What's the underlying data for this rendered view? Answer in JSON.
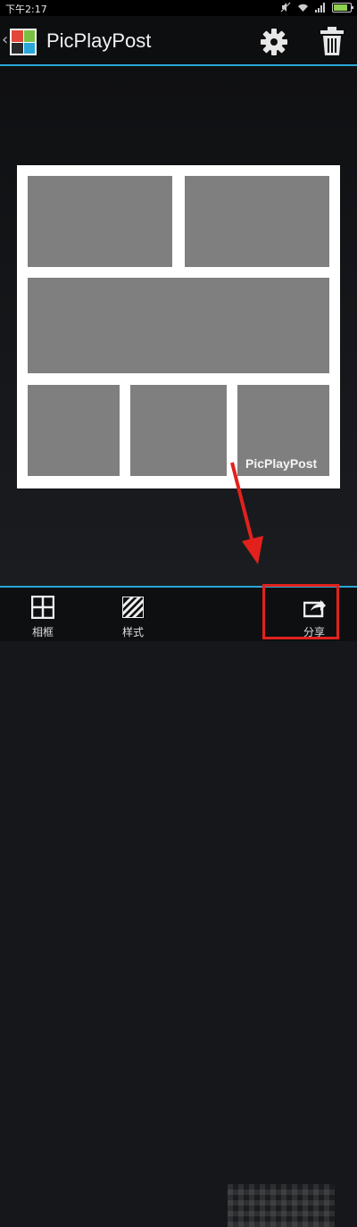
{
  "status_bar": {
    "time": "下午2:17"
  },
  "header": {
    "title": "PicPlayPost",
    "settings_icon": "gear-icon",
    "delete_icon": "trash-icon",
    "back_icon": "chevron-left-icon"
  },
  "collage": {
    "watermark": "PicPlayPost",
    "cell_count": 6
  },
  "bottom_nav": {
    "items": [
      {
        "label": "相框",
        "icon": "grid-frame-icon"
      },
      {
        "label": "样式",
        "icon": "stripes-style-icon"
      },
      {
        "label": "分享",
        "icon": "share-icon"
      }
    ]
  },
  "colors": {
    "accent": "#2aa7d8",
    "highlight": "#e2211c",
    "cell": "#7f7f7f"
  }
}
